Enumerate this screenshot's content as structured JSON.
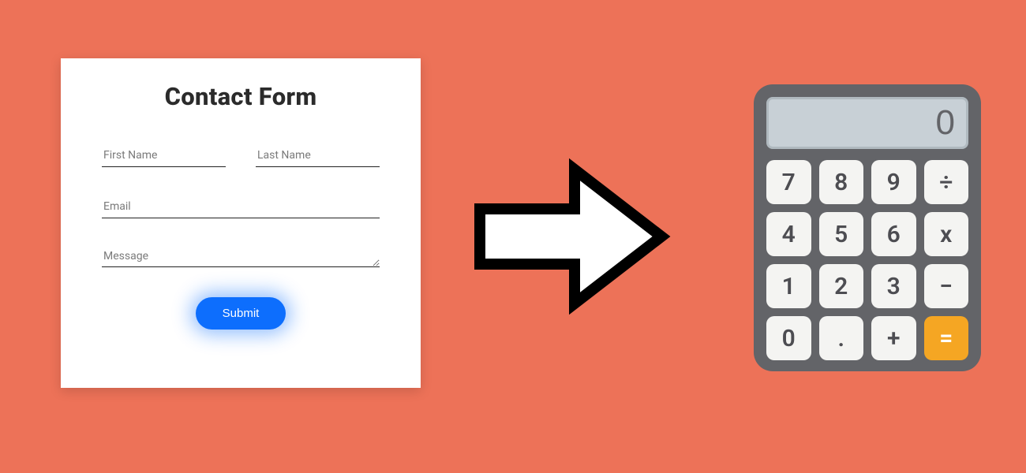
{
  "form": {
    "title": "Contact Form",
    "first_name_placeholder": "First Name",
    "last_name_placeholder": "Last Name",
    "email_placeholder": "Email",
    "message_placeholder": "Message",
    "submit_label": "Submit"
  },
  "calculator": {
    "display": "0",
    "keys": {
      "k7": "7",
      "k8": "8",
      "k9": "9",
      "div": "÷",
      "k4": "4",
      "k5": "5",
      "k6": "6",
      "mul": "x",
      "k1": "1",
      "k2": "2",
      "k3": "3",
      "sub": "−",
      "k0": "0",
      "dot": ".",
      "add": "+",
      "eq": "="
    }
  }
}
